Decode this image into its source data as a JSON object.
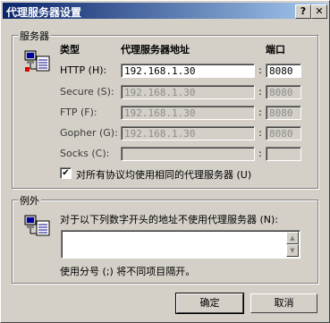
{
  "window": {
    "title": "代理服务器设置",
    "help_label": "?",
    "close_label": "✕"
  },
  "servers": {
    "group_label": "服务器",
    "col_type": "类型",
    "col_address": "代理服务器地址",
    "col_port": "端口",
    "rows": [
      {
        "label": "HTTP (H):",
        "address": "192.168.1.30",
        "port": "8080",
        "enabled": true
      },
      {
        "label": "Secure (S):",
        "address": "192.168.1.30",
        "port": "8080",
        "enabled": false
      },
      {
        "label": "FTP (F):",
        "address": "192.168.1.30",
        "port": "8080",
        "enabled": false
      },
      {
        "label": "Gopher (G):",
        "address": "192.168.1.30",
        "port": "8080",
        "enabled": false
      },
      {
        "label": "Socks (C):",
        "address": "",
        "port": "",
        "enabled": false
      }
    ],
    "same_proxy_label": "对所有协议均使用相同的代理服务器 (U)",
    "same_proxy_checked": true
  },
  "exceptions": {
    "group_label": "例外",
    "instruction": "对于以下列数字开头的地址不使用代理服务器 (N):",
    "value": "",
    "hint": "使用分号 (;) 将不同项目隔开。"
  },
  "buttons": {
    "ok": "确定",
    "cancel": "取消"
  }
}
